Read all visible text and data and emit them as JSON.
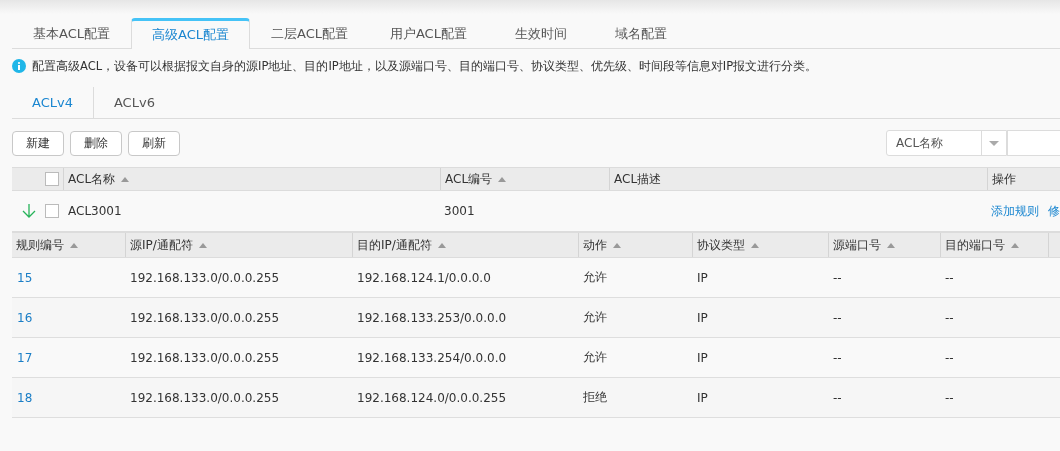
{
  "tabs": [
    {
      "label": "基本ACL配置",
      "selected": false
    },
    {
      "label": "高级ACL配置",
      "selected": true
    },
    {
      "label": "二层ACL配置",
      "selected": false
    },
    {
      "label": "用户ACL配置",
      "selected": false
    },
    {
      "label": "生效时间",
      "selected": false
    },
    {
      "label": "域名配置",
      "selected": false
    }
  ],
  "info": "配置高级ACL，设备可以根据报文自身的源IP地址、目的IP地址，以及源端口号、目的端口号、协议类型、优先级、时间段等信息对IP报文进行分类。",
  "subtabs": [
    {
      "label": "ACLv4",
      "selected": true
    },
    {
      "label": "ACLv6",
      "selected": false
    }
  ],
  "buttons": [
    "新建",
    "删除",
    "刷新"
  ],
  "search": {
    "field": "ACL名称"
  },
  "acl_table": {
    "select_all_checked": false,
    "columns": [
      "ACL名称",
      "ACL编号",
      "ACL描述",
      "操作"
    ],
    "rows": [
      {
        "expanded": true,
        "checked": false,
        "name": "ACL3001",
        "number": "3001",
        "actions": [
          "添加规则",
          "修"
        ]
      }
    ]
  },
  "rule_table": {
    "columns": [
      "规则编号",
      "源IP/通配符",
      "目的IP/通配符",
      "动作",
      "协议类型",
      "源端口号",
      "目的端口号"
    ],
    "rows": [
      {
        "cells": [
          "15",
          "192.168.133.0/0.0.0.255",
          "192.168.124.1/0.0.0.0",
          "允许",
          "IP",
          "--",
          "--"
        ]
      },
      {
        "cells": [
          "16",
          "192.168.133.0/0.0.0.255",
          "192.168.133.253/0.0.0.0",
          "允许",
          "IP",
          "--",
          "--"
        ]
      },
      {
        "cells": [
          "17",
          "192.168.133.0/0.0.0.255",
          "192.168.133.254/0.0.0.0",
          "允许",
          "IP",
          "--",
          "--"
        ]
      },
      {
        "cells": [
          "18",
          "192.168.133.0/0.0.0.255",
          "192.168.124.0/0.0.0.255",
          "拒绝",
          "IP",
          "--",
          "--"
        ]
      }
    ]
  }
}
